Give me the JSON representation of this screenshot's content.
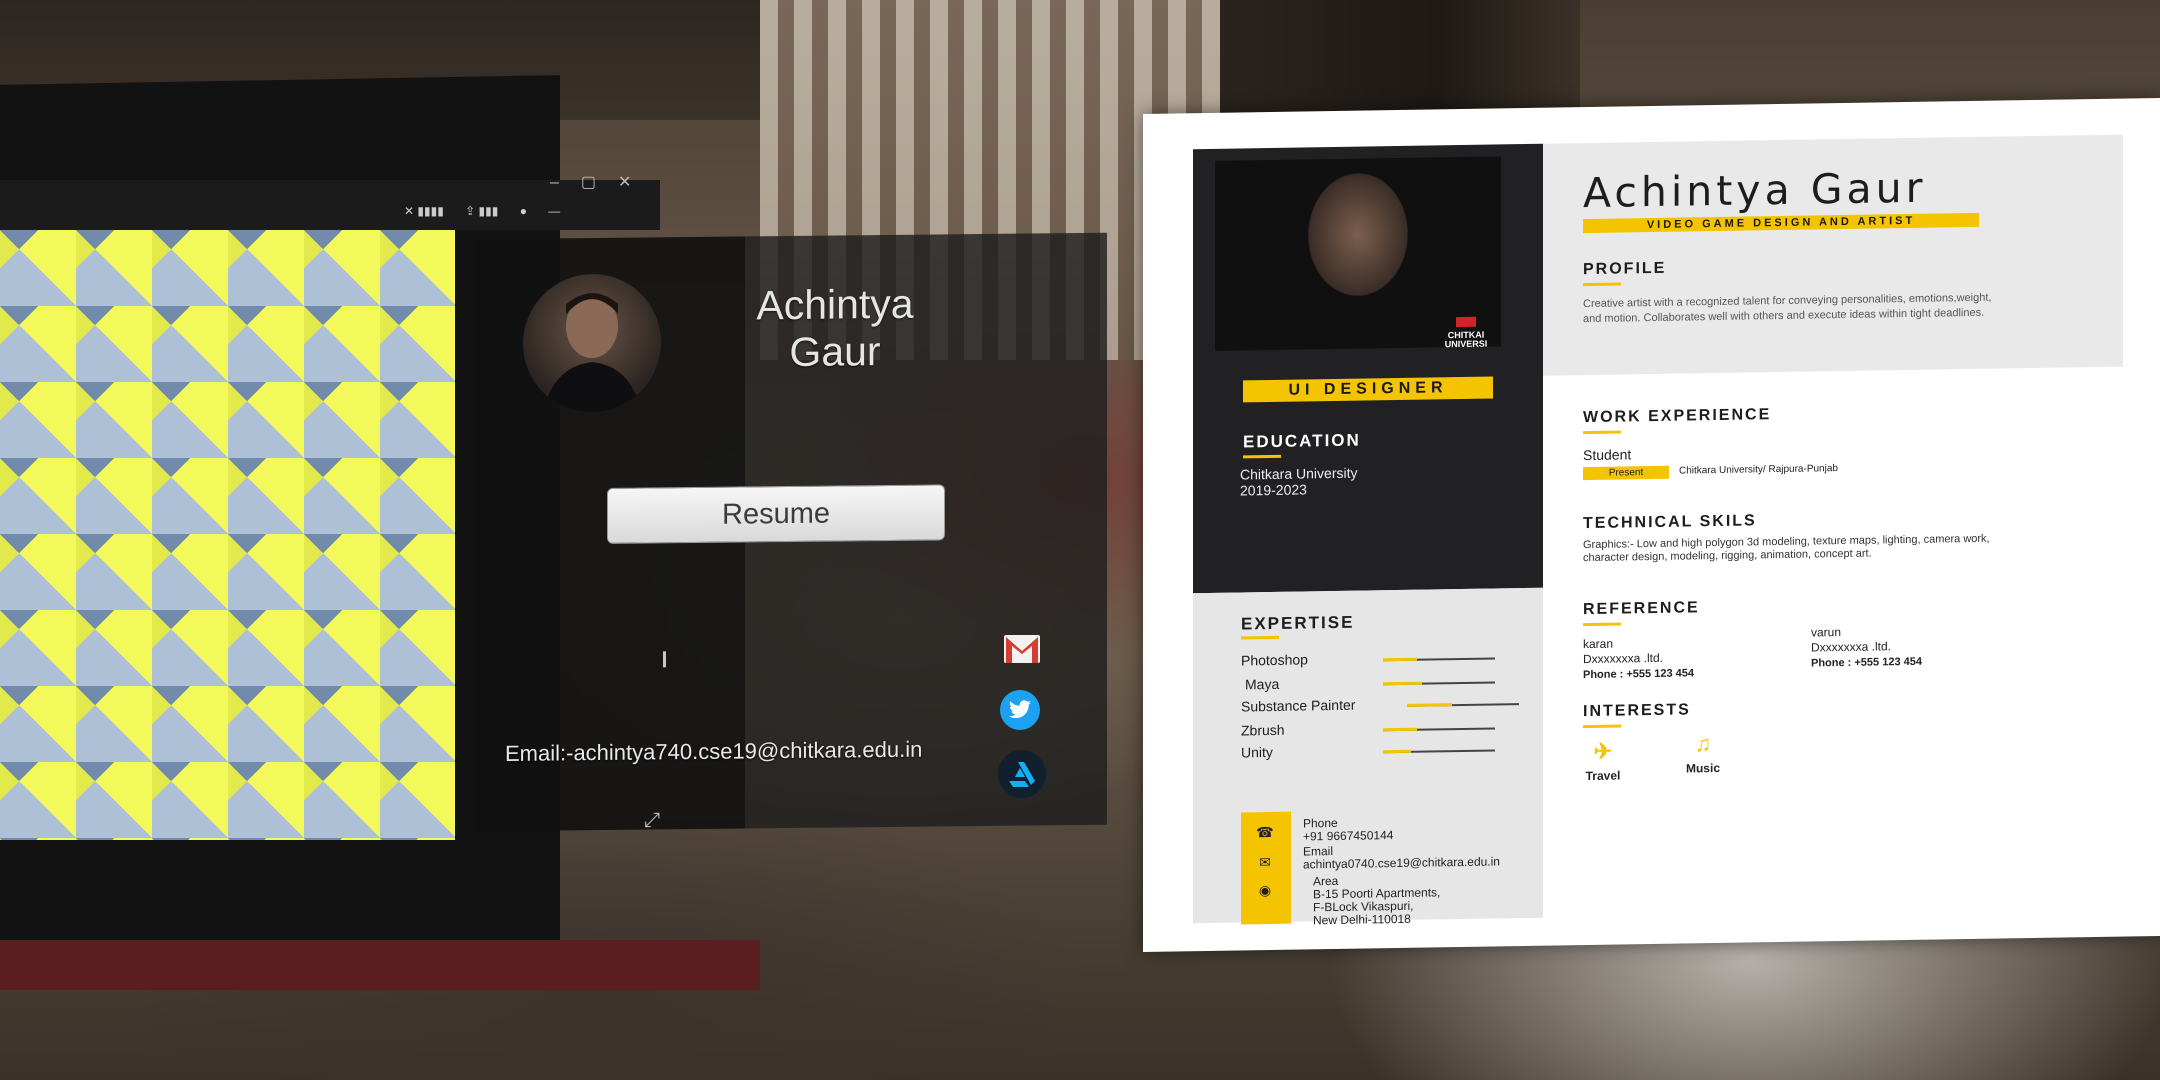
{
  "vr_panel": {
    "name_line1": "Achintya",
    "name_line2": "Gaur",
    "resume_button": "Resume",
    "email_label": "Email:-achintya740.cse19@chitkara.edu.in",
    "social_icons": [
      "gmail-icon",
      "twitter-icon",
      "artstation-icon"
    ]
  },
  "resume": {
    "name": "Achintya Gaur",
    "tagline": "VIDEO GAME DESIGN AND ARTIST",
    "role_badge": "UI DESIGNER",
    "photo_logo": "CHITKAI UNIVERSI",
    "profile": {
      "title": "PROFILE",
      "text": "Creative artist with a  recognized talent for conveying personalities, emotions,weight, and motion. Collaborates well with others and execute ideas within tight deadlines."
    },
    "education": {
      "title": "EDUCATION",
      "school": "Chitkara University",
      "years": "2019-2023"
    },
    "expertise": {
      "title": "EXPERTISE",
      "skills": [
        {
          "name": "Photoshop",
          "level": 0.3
        },
        {
          "name": "Maya",
          "level": 0.35
        },
        {
          "name": "Substance Painter",
          "level": 0.4
        },
        {
          "name": "Zbrush",
          "level": 0.3
        },
        {
          "name": "Unity",
          "level": 0.25
        }
      ]
    },
    "contact": {
      "phone_label": "Phone",
      "phone": "+91 9667450144",
      "email_label": "Email",
      "email": "achintya0740.cse19@chitkara.edu.in",
      "area_label": "Area",
      "address_line1": "B-15 Poorti Apartments,",
      "address_line2": "F-BLock Vikaspuri,",
      "address_line3": "New Delhi-110018"
    },
    "work": {
      "title": "WORK EXPERIENCE",
      "position": "Student",
      "status": "Present",
      "company": "Chitkara University/ Rajpura-Punjab"
    },
    "technical": {
      "title": "TECHNICAL SKILS",
      "text": "Graphics:- Low and high polygon 3d modeling,  texture maps, lighting, camera work, character design, modeling, rigging, animation, concept art."
    },
    "reference": {
      "title": "REFERENCE",
      "refs": [
        {
          "name": "karan",
          "company": "Dxxxxxxxa .ltd.",
          "phone": "Phone : +555 123 454"
        },
        {
          "name": "varun",
          "company": "Dxxxxxxxa .ltd.",
          "phone": "Phone : +555 123 454"
        }
      ]
    },
    "interests": {
      "title": "INTERESTS",
      "items": [
        {
          "label": "Travel",
          "icon": "plane-icon"
        },
        {
          "label": "Music",
          "icon": "headphones-icon"
        }
      ]
    }
  },
  "colors": {
    "accent": "#f5c400",
    "dark_panel": "#212123",
    "twitter": "#1da1f2"
  }
}
